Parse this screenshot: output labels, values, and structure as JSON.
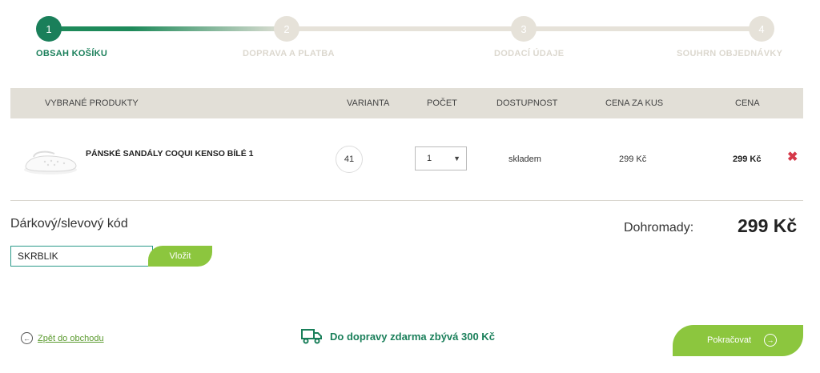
{
  "steps": [
    {
      "number": "1",
      "label": "OBSAH KOŠÍKU",
      "active": true
    },
    {
      "number": "2",
      "label": "DOPRAVA A PLATBA",
      "active": false
    },
    {
      "number": "3",
      "label": "DODACÍ ÚDAJE",
      "active": false
    },
    {
      "number": "4",
      "label": "SOUHRN OBJEDNÁVKY",
      "active": false
    }
  ],
  "table": {
    "headers": {
      "products": "VYBRANÉ PRODUKTY",
      "variant": "VARIANTA",
      "quantity": "POČET",
      "availability": "DOSTUPNOST",
      "unit_price": "CENA ZA KUS",
      "price": "CENA"
    },
    "rows": [
      {
        "name": "PÁNSKÉ SANDÁLY COQUI KENSO BÍLÉ 1",
        "variant": "41",
        "quantity": "1",
        "availability": "skladem",
        "unit_price": "299 Kč",
        "price": "299 Kč",
        "remove_icon": "close-icon"
      }
    ]
  },
  "discount": {
    "title": "Dárkový/slevový kód",
    "value": "SKRBLIK",
    "button": "Vložit"
  },
  "total": {
    "label": "Dohromady:",
    "value": "299 Kč"
  },
  "footer": {
    "back_link": "Zpět do obchodu",
    "shipping_text": "Do dopravy zdarma zbývá 300 Kč",
    "continue_button": "Pokračovat"
  },
  "colors": {
    "primary_green": "#1a7f5a",
    "accent_lime": "#8cc63e",
    "header_bg": "#e2dfd7",
    "remove_red": "#d6394a"
  }
}
